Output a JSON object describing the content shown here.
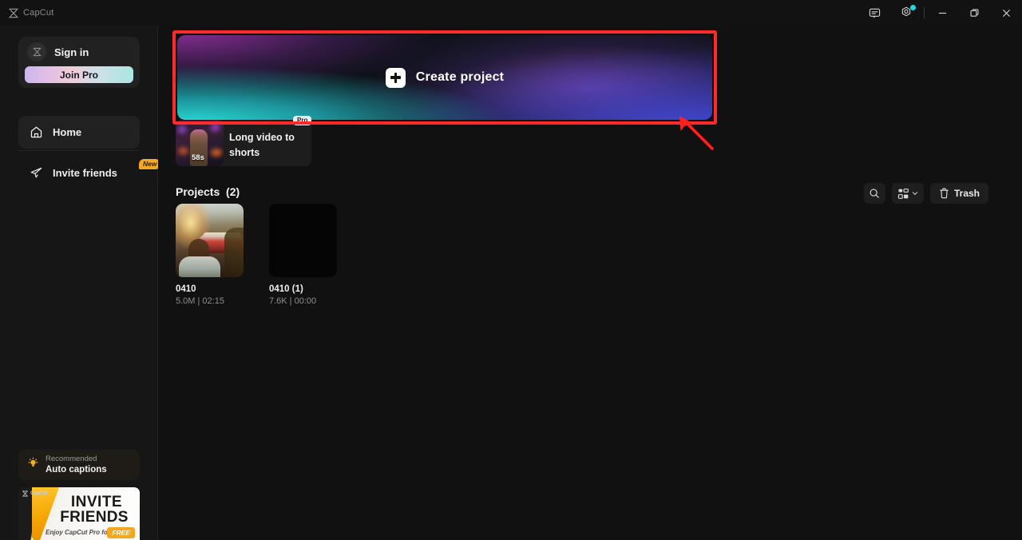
{
  "titlebar": {
    "app_name": "CapCut",
    "logo_icon": "capcut-hourglass-icon",
    "feedback_icon": "chat-feedback-icon",
    "settings_icon": "gear-icon",
    "settings_has_notification": true,
    "notification_dot_color": "#22d7e0",
    "minimize_icon": "minimize-icon",
    "maximize_icon": "maximize-restore-icon",
    "close_icon": "close-icon"
  },
  "sidebar": {
    "account": {
      "avatar_icon": "capcut-avatar-icon",
      "signin_label": "Sign in",
      "join_pro_label": "Join Pro"
    },
    "nav": [
      {
        "label": "Home",
        "icon": "home-icon",
        "active": true,
        "badge": null
      },
      {
        "label": "Invite friends",
        "icon": "paper-plane-icon",
        "active": false,
        "badge": "New"
      }
    ],
    "recommended": {
      "icon": "lightbulb-icon",
      "eyebrow": "Recommended",
      "title": "Auto captions"
    },
    "promo": {
      "logo_label": "CapCut",
      "line1": "INVITE",
      "line2": "FRIENDS",
      "tagline": "Enjoy CapCut Pro for",
      "free_badge": "FREE"
    }
  },
  "main": {
    "create_banner": {
      "label": "Create project",
      "icon": "plus-square-icon",
      "highlighted": true,
      "highlight_color": "#ff2b2b",
      "annotation_arrow": "red-arrow-pointing-to-create-project"
    },
    "feature_card": {
      "title": "Long video to shorts",
      "badge": "Pro",
      "duration": "58s"
    },
    "projects_section": {
      "heading": "Projects",
      "count": "(2)",
      "toolbar": {
        "search_icon": "search-icon",
        "view_icon": "grid-view-icon",
        "view_chevron_icon": "chevron-down-icon",
        "trash_icon": "trash-icon",
        "trash_label": "Trash"
      },
      "projects": [
        {
          "name": "0410",
          "meta": "5.0M | 02:15",
          "thumb": "sunset-car-scene"
        },
        {
          "name": "0410 (1)",
          "meta": "7.6K | 00:00",
          "thumb": "black-empty"
        }
      ]
    }
  }
}
